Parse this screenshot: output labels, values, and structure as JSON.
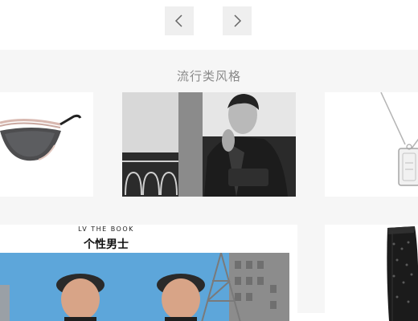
{
  "nav": {
    "prev_icon": "chevron-left-icon",
    "next_icon": "chevron-right-icon"
  },
  "section": {
    "title": "流行类风格"
  },
  "book_card": {
    "kicker": "LV THE BOOK",
    "title": "个性男士"
  },
  "products": [
    {
      "name": "sunglasses"
    },
    {
      "name": "portrait-photo"
    },
    {
      "name": "necklace"
    },
    {
      "name": "rain-boot"
    }
  ]
}
